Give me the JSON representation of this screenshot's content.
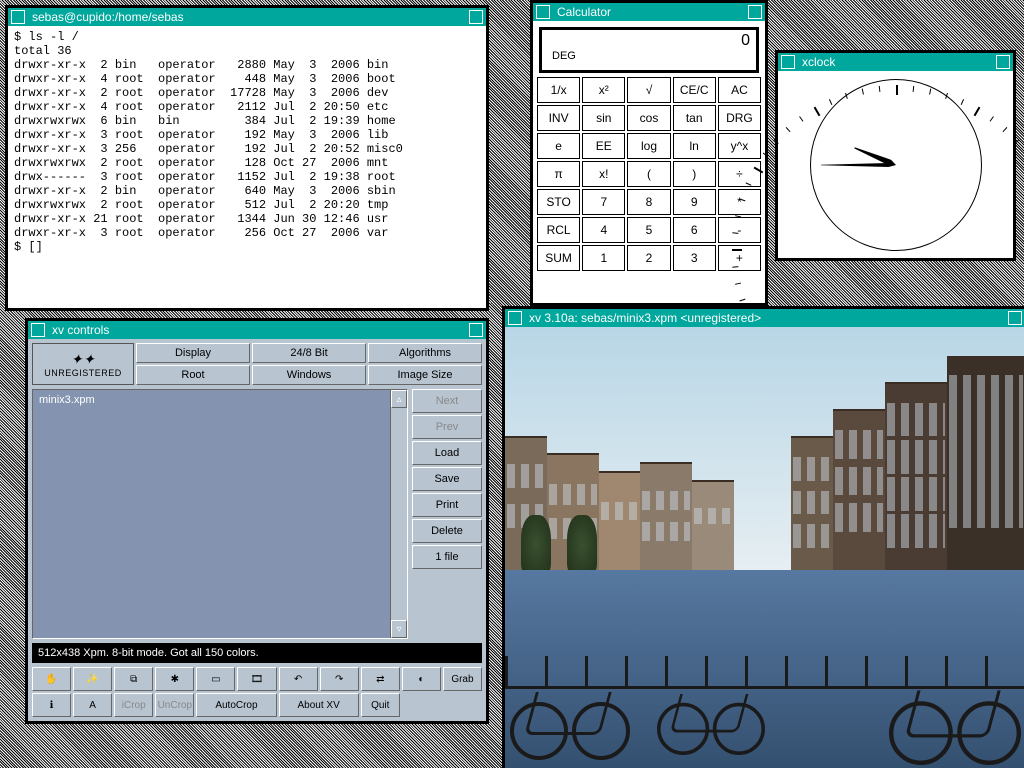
{
  "terminal": {
    "title": "sebas@cupido:/home/sebas",
    "prompt": "$ ",
    "command": "ls -l /",
    "total_line": "total 36",
    "rows": [
      "drwxr-xr-x  2 bin   operator   2880 May  3  2006 bin",
      "drwxr-xr-x  4 root  operator    448 May  3  2006 boot",
      "drwxr-xr-x  2 root  operator  17728 May  3  2006 dev",
      "drwxr-xr-x  4 root  operator   2112 Jul  2 20:50 etc",
      "drwxrwxrwx  6 bin   bin         384 Jul  2 19:39 home",
      "drwxr-xr-x  3 root  operator    192 May  3  2006 lib",
      "drwxr-xr-x  3 256   operator    192 Jul  2 20:52 misc0",
      "drwxrwxrwx  2 root  operator    128 Oct 27  2006 mnt",
      "drwx------  3 root  operator   1152 Jul  2 19:38 root",
      "drwxr-xr-x  2 bin   operator    640 May  3  2006 sbin",
      "drwxrwxrwx  2 root  operator    512 Jul  2 20:20 tmp",
      "drwxr-xr-x 21 root  operator   1344 Jun 30 12:46 usr",
      "drwxr-xr-x  3 root  operator    256 Oct 27  2006 var"
    ],
    "cursor": "[]"
  },
  "calc": {
    "title": "Calculator",
    "display_value": "0",
    "display_mode": "DEG",
    "buttons": [
      "1/x",
      "x²",
      "√",
      "CE/C",
      "AC",
      "INV",
      "sin",
      "cos",
      "tan",
      "DRG",
      "e",
      "EE",
      "log",
      "ln",
      "y^x",
      "π",
      "x!",
      "(",
      ")",
      "÷",
      "STO",
      "7",
      "8",
      "9",
      "*",
      "RCL",
      "4",
      "5",
      "6",
      "-",
      "SUM",
      "1",
      "2",
      "3",
      "+"
    ]
  },
  "xclock": {
    "title": "xclock",
    "hour": 9,
    "minute": 45
  },
  "xv_controls": {
    "title": "xv controls",
    "logo_label": "UNREGISTERED",
    "top_buttons": [
      "Display",
      "24/8 Bit",
      "Algorithms",
      "Root",
      "Windows",
      "Image Size"
    ],
    "file_list": [
      "minix3.xpm"
    ],
    "side_buttons": [
      {
        "label": "Next",
        "disabled": true
      },
      {
        "label": "Prev",
        "disabled": true
      },
      {
        "label": "Load",
        "disabled": false
      },
      {
        "label": "Save",
        "disabled": false
      },
      {
        "label": "Print",
        "disabled": false
      },
      {
        "label": "Delete",
        "disabled": false
      },
      {
        "label": "1 file",
        "disabled": false
      }
    ],
    "status": "512x438 Xpm.  8-bit mode.  Got all 150 colors.",
    "tool_row1_icons": [
      "hand-icon",
      "wand-icon",
      "copy-icon",
      "bug-icon",
      "screen-icon",
      "film-icon",
      "undo-icon",
      "redo-icon",
      "shuffle-icon",
      "contrast-icon"
    ],
    "tool_row1_end": "Grab",
    "tool_row2_icons": [
      "info-icon",
      "text-icon"
    ],
    "tool_row2_btns": [
      "iCrop",
      "UnCrop",
      "AutoCrop",
      "About XV",
      "Quit"
    ],
    "tool_row2_disabled": [
      "iCrop",
      "UnCrop"
    ]
  },
  "xv_image": {
    "title": "xv 3.10a: sebas/minix3.xpm <unregistered>"
  }
}
